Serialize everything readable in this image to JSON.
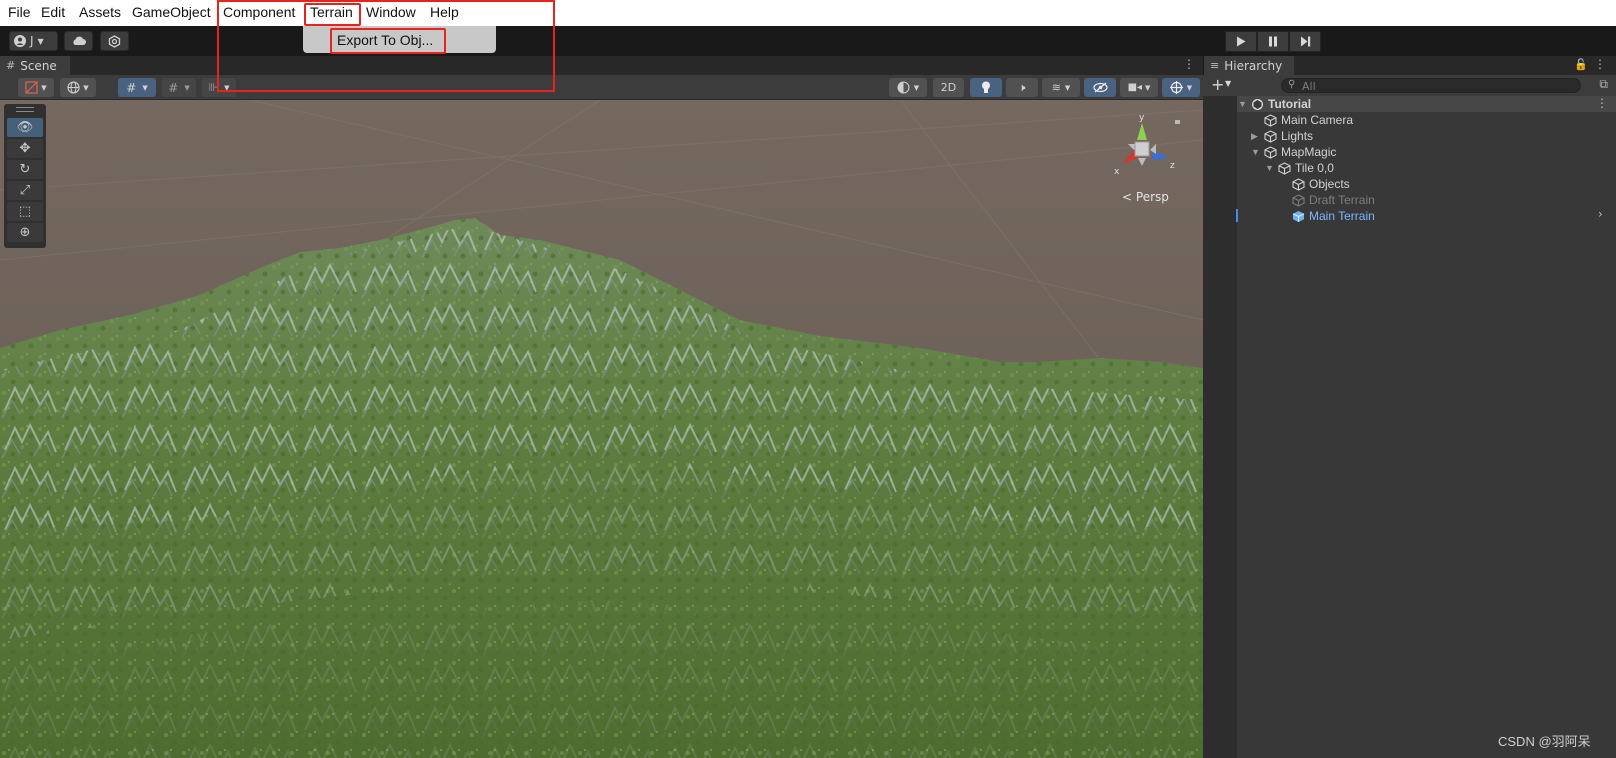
{
  "menubar": {
    "items": [
      "File",
      "Edit",
      "Assets",
      "GameObject",
      "Component",
      "Terrain",
      "Window",
      "Help"
    ]
  },
  "dropdown": {
    "items": [
      "Export To Obj..."
    ]
  },
  "toolbar": {
    "account_label": "J",
    "play_icons": [
      "play-icon",
      "pause-icon",
      "step-icon"
    ]
  },
  "scene": {
    "tab_label": "Scene",
    "toggle_2d_label": "2D",
    "persp_label": "Persp",
    "gizmo_axes": {
      "x": "x",
      "y": "y",
      "z": "z"
    },
    "tools": [
      "view-tool-icon",
      "move-tool-icon",
      "rotate-tool-icon",
      "scale-tool-icon",
      "rect-tool-icon",
      "transform-tool-icon"
    ]
  },
  "hierarchy": {
    "tab_label": "Hierarchy",
    "search_placeholder": "All",
    "items": [
      {
        "label": "Tutorial",
        "depth": 0,
        "expanded": true,
        "type": "scene"
      },
      {
        "label": "Main Camera",
        "depth": 1,
        "type": "object"
      },
      {
        "label": "Lights",
        "depth": 1,
        "collapsed": true,
        "type": "object"
      },
      {
        "label": "MapMagic",
        "depth": 1,
        "expanded": true,
        "type": "object"
      },
      {
        "label": "Tile 0,0",
        "depth": 2,
        "expanded": true,
        "type": "object"
      },
      {
        "label": "Objects",
        "depth": 3,
        "type": "object"
      },
      {
        "label": "Draft Terrain",
        "depth": 3,
        "type": "object",
        "inactive": true
      },
      {
        "label": "Main Terrain",
        "depth": 3,
        "type": "object",
        "selected": true
      }
    ]
  },
  "watermark": "CSDN @羽阿呆",
  "colors": {
    "highlight_red": "#e5251d",
    "selection_blue": "#7bb7ff",
    "editor_dark": "#383838"
  }
}
